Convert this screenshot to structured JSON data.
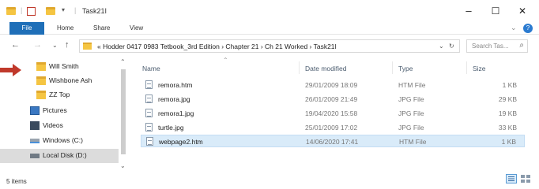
{
  "window": {
    "title": "Task21I",
    "minimize": "–",
    "maximize": "☐",
    "close": "✕"
  },
  "ribbon": {
    "file": "File",
    "home": "Home",
    "share": "Share",
    "view": "View",
    "expand": "⌄",
    "help": "?"
  },
  "address": {
    "breadcrumb": "« Hodder 0417 0983 Tetbook_3rd Edition  ›  Chapter 21  ›  Ch 21 Worked  ›  Task21I",
    "dropdown": "⌄",
    "refresh": "↻",
    "search_placeholder": "Search Tas...",
    "search_icon": "⌕"
  },
  "nav": {
    "back": "←",
    "forward": "→",
    "recent": "⌄",
    "up": "↑"
  },
  "sidebar": {
    "items": [
      {
        "label": "Will Smith",
        "icon": "folder-icon"
      },
      {
        "label": "Wishbone Ash",
        "icon": "folder-icon"
      },
      {
        "label": "ZZ Top",
        "icon": "folder-icon"
      },
      {
        "label": "Pictures",
        "icon": "pictures-icon"
      },
      {
        "label": "Videos",
        "icon": "videos-icon"
      },
      {
        "label": "Windows (C:)",
        "icon": "drive-icon"
      },
      {
        "label": "Local Disk (D:)",
        "icon": "disk-icon"
      }
    ]
  },
  "columns": {
    "name": "Name",
    "date": "Date modified",
    "type": "Type",
    "size": "Size"
  },
  "files": [
    {
      "name": "remora.htm",
      "date": "29/01/2009 18:09",
      "type": "HTM File",
      "size": "1 KB"
    },
    {
      "name": "remora.jpg",
      "date": "26/01/2009 21:49",
      "type": "JPG File",
      "size": "29 KB"
    },
    {
      "name": "remora1.jpg",
      "date": "19/04/2020 15:58",
      "type": "JPG File",
      "size": "19 KB"
    },
    {
      "name": "turtle.jpg",
      "date": "25/01/2009 17:02",
      "type": "JPG File",
      "size": "33 KB"
    },
    {
      "name": "webpage2.htm",
      "date": "14/06/2020 17:41",
      "type": "HTM File",
      "size": "1 KB"
    }
  ],
  "status": {
    "count": "5 items"
  },
  "colors": {
    "accent": "#1f6fb8",
    "folder": "#f5c542",
    "selection": "#d9ebf9",
    "pointer": "#c0392b"
  }
}
